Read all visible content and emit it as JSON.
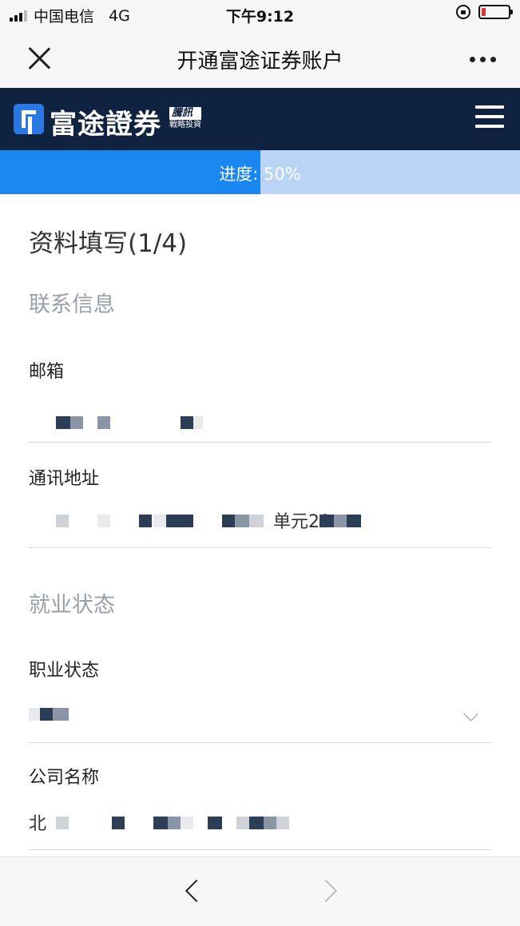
{
  "status_bar": {
    "carrier": "中国电信",
    "network": "4G",
    "time": "下午9:12",
    "battery_level": 0.15
  },
  "nav": {
    "title": "开通富途证券账户"
  },
  "brand": {
    "name": "富途證券",
    "badge": "騰訊",
    "badge_sub": "戰略投資",
    "colors": {
      "bar": "#0f2240",
      "logo": "#2a78e4"
    }
  },
  "progress": {
    "label": "进度: 50%",
    "percent": 50,
    "colors": {
      "fill": "#1a86ef",
      "track": "#b9d4f5"
    }
  },
  "form": {
    "heading": "资料填写(1/4)",
    "contact_section": "联系信息",
    "email_label": "邮箱",
    "email_value": "",
    "address_label": "通讯地址",
    "address_value_partial": "单元20",
    "employment_section": "就业状态",
    "occupation_label": "职业状态",
    "occupation_value_partial": "",
    "company_label": "公司名称",
    "company_value_partial": "北"
  },
  "icons": {
    "close": "close-icon",
    "more": "more-dots-icon",
    "menu": "hamburger-icon",
    "select": "chevron-down-icon",
    "back": "back-arrow-icon",
    "forward": "forward-arrow-icon"
  }
}
